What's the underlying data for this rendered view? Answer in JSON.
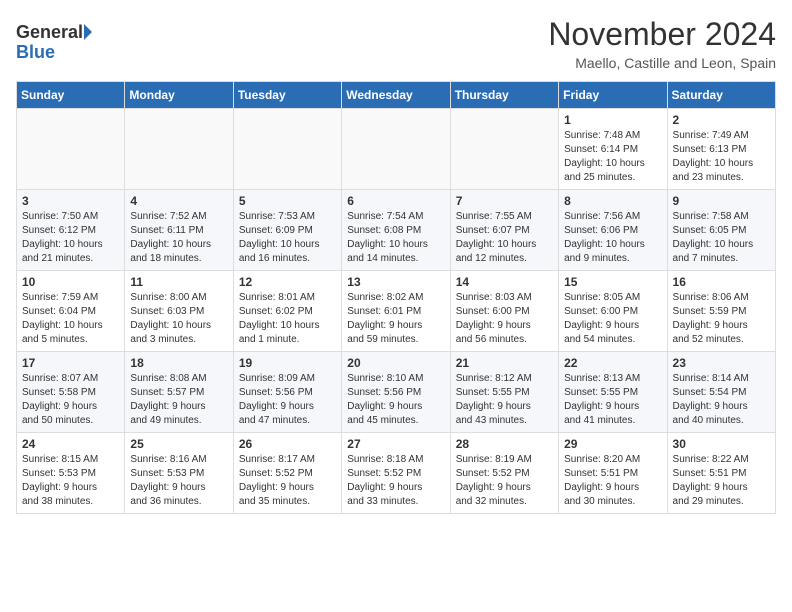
{
  "header": {
    "logo_general": "General",
    "logo_blue": "Blue",
    "month_year": "November 2024",
    "location": "Maello, Castille and Leon, Spain"
  },
  "weekdays": [
    "Sunday",
    "Monday",
    "Tuesday",
    "Wednesday",
    "Thursday",
    "Friday",
    "Saturday"
  ],
  "weeks": [
    [
      {
        "day": "",
        "info": ""
      },
      {
        "day": "",
        "info": ""
      },
      {
        "day": "",
        "info": ""
      },
      {
        "day": "",
        "info": ""
      },
      {
        "day": "",
        "info": ""
      },
      {
        "day": "1",
        "info": "Sunrise: 7:48 AM\nSunset: 6:14 PM\nDaylight: 10 hours\nand 25 minutes."
      },
      {
        "day": "2",
        "info": "Sunrise: 7:49 AM\nSunset: 6:13 PM\nDaylight: 10 hours\nand 23 minutes."
      }
    ],
    [
      {
        "day": "3",
        "info": "Sunrise: 7:50 AM\nSunset: 6:12 PM\nDaylight: 10 hours\nand 21 minutes."
      },
      {
        "day": "4",
        "info": "Sunrise: 7:52 AM\nSunset: 6:11 PM\nDaylight: 10 hours\nand 18 minutes."
      },
      {
        "day": "5",
        "info": "Sunrise: 7:53 AM\nSunset: 6:09 PM\nDaylight: 10 hours\nand 16 minutes."
      },
      {
        "day": "6",
        "info": "Sunrise: 7:54 AM\nSunset: 6:08 PM\nDaylight: 10 hours\nand 14 minutes."
      },
      {
        "day": "7",
        "info": "Sunrise: 7:55 AM\nSunset: 6:07 PM\nDaylight: 10 hours\nand 12 minutes."
      },
      {
        "day": "8",
        "info": "Sunrise: 7:56 AM\nSunset: 6:06 PM\nDaylight: 10 hours\nand 9 minutes."
      },
      {
        "day": "9",
        "info": "Sunrise: 7:58 AM\nSunset: 6:05 PM\nDaylight: 10 hours\nand 7 minutes."
      }
    ],
    [
      {
        "day": "10",
        "info": "Sunrise: 7:59 AM\nSunset: 6:04 PM\nDaylight: 10 hours\nand 5 minutes."
      },
      {
        "day": "11",
        "info": "Sunrise: 8:00 AM\nSunset: 6:03 PM\nDaylight: 10 hours\nand 3 minutes."
      },
      {
        "day": "12",
        "info": "Sunrise: 8:01 AM\nSunset: 6:02 PM\nDaylight: 10 hours\nand 1 minute."
      },
      {
        "day": "13",
        "info": "Sunrise: 8:02 AM\nSunset: 6:01 PM\nDaylight: 9 hours\nand 59 minutes."
      },
      {
        "day": "14",
        "info": "Sunrise: 8:03 AM\nSunset: 6:00 PM\nDaylight: 9 hours\nand 56 minutes."
      },
      {
        "day": "15",
        "info": "Sunrise: 8:05 AM\nSunset: 6:00 PM\nDaylight: 9 hours\nand 54 minutes."
      },
      {
        "day": "16",
        "info": "Sunrise: 8:06 AM\nSunset: 5:59 PM\nDaylight: 9 hours\nand 52 minutes."
      }
    ],
    [
      {
        "day": "17",
        "info": "Sunrise: 8:07 AM\nSunset: 5:58 PM\nDaylight: 9 hours\nand 50 minutes."
      },
      {
        "day": "18",
        "info": "Sunrise: 8:08 AM\nSunset: 5:57 PM\nDaylight: 9 hours\nand 49 minutes."
      },
      {
        "day": "19",
        "info": "Sunrise: 8:09 AM\nSunset: 5:56 PM\nDaylight: 9 hours\nand 47 minutes."
      },
      {
        "day": "20",
        "info": "Sunrise: 8:10 AM\nSunset: 5:56 PM\nDaylight: 9 hours\nand 45 minutes."
      },
      {
        "day": "21",
        "info": "Sunrise: 8:12 AM\nSunset: 5:55 PM\nDaylight: 9 hours\nand 43 minutes."
      },
      {
        "day": "22",
        "info": "Sunrise: 8:13 AM\nSunset: 5:55 PM\nDaylight: 9 hours\nand 41 minutes."
      },
      {
        "day": "23",
        "info": "Sunrise: 8:14 AM\nSunset: 5:54 PM\nDaylight: 9 hours\nand 40 minutes."
      }
    ],
    [
      {
        "day": "24",
        "info": "Sunrise: 8:15 AM\nSunset: 5:53 PM\nDaylight: 9 hours\nand 38 minutes."
      },
      {
        "day": "25",
        "info": "Sunrise: 8:16 AM\nSunset: 5:53 PM\nDaylight: 9 hours\nand 36 minutes."
      },
      {
        "day": "26",
        "info": "Sunrise: 8:17 AM\nSunset: 5:52 PM\nDaylight: 9 hours\nand 35 minutes."
      },
      {
        "day": "27",
        "info": "Sunrise: 8:18 AM\nSunset: 5:52 PM\nDaylight: 9 hours\nand 33 minutes."
      },
      {
        "day": "28",
        "info": "Sunrise: 8:19 AM\nSunset: 5:52 PM\nDaylight: 9 hours\nand 32 minutes."
      },
      {
        "day": "29",
        "info": "Sunrise: 8:20 AM\nSunset: 5:51 PM\nDaylight: 9 hours\nand 30 minutes."
      },
      {
        "day": "30",
        "info": "Sunrise: 8:22 AM\nSunset: 5:51 PM\nDaylight: 9 hours\nand 29 minutes."
      }
    ]
  ]
}
